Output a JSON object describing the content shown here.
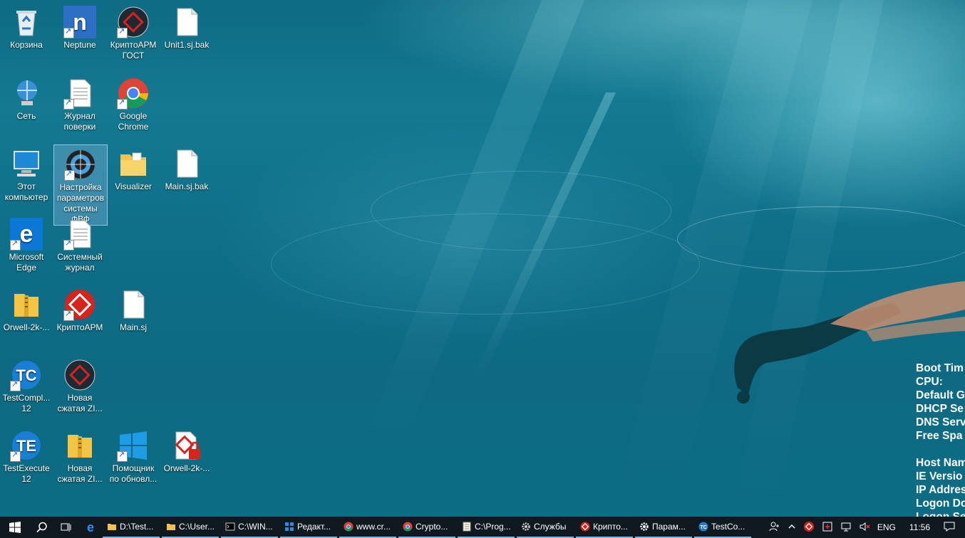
{
  "desktop": {
    "icons": [
      {
        "label": "Корзина"
      },
      {
        "label": "Neptune"
      },
      {
        "label": "КриптоАРМ ГОСТ"
      },
      {
        "label": "Unit1.sj.bak"
      },
      {
        "label": "Сеть"
      },
      {
        "label": "Журнал поверки"
      },
      {
        "label": "Google Chrome"
      },
      {
        "label": "Этот компьютер"
      },
      {
        "label": "Настройка параметров системы ФВФ"
      },
      {
        "label": "Visualizer"
      },
      {
        "label": "Main.sj.bak"
      },
      {
        "label": "Microsoft Edge"
      },
      {
        "label": "Системный журнал"
      },
      {
        "label": "Orwell-2k-..."
      },
      {
        "label": "КриптоАРМ"
      },
      {
        "label": "Main.sj"
      },
      {
        "label": "TestCompl... 12"
      },
      {
        "label": "Новая сжатая ZI..."
      },
      {
        "label": "TestExecute 12"
      },
      {
        "label": "Новая сжатая ZI..."
      },
      {
        "label": "Помощник по обновл..."
      },
      {
        "label": "Orwell-2k-..."
      }
    ]
  },
  "bginfo": {
    "lines": [
      "Boot Tim",
      "CPU:",
      "Default G",
      "DHCP Se",
      "DNS Serv",
      "Free Spa",
      "",
      "Host Nam",
      "IE Versio",
      "IP Addres",
      "Logon Do",
      "Logon Se"
    ]
  },
  "taskbar": {
    "tasks": [
      {
        "label": "D:\\Test...",
        "icon": "folder-icon"
      },
      {
        "label": "C:\\User...",
        "icon": "folder-icon"
      },
      {
        "label": "C:\\WIN...",
        "icon": "console-icon"
      },
      {
        "label": "Редакт...",
        "icon": "editor-icon"
      },
      {
        "label": "www.cr...",
        "icon": "chrome-icon"
      },
      {
        "label": "Crypto...",
        "icon": "chrome-icon"
      },
      {
        "label": "C:\\Prog...",
        "icon": "notepad-icon"
      },
      {
        "label": "Службы",
        "icon": "gear-icon"
      },
      {
        "label": "Крипто...",
        "icon": "crypto-icon"
      },
      {
        "label": "Парам...",
        "icon": "gear-icon"
      },
      {
        "label": "TestCo...",
        "icon": "testcomplete-icon"
      }
    ],
    "tray": {
      "language": "ENG",
      "time": "11:56"
    }
  },
  "colors": {
    "taskbar": "#101820",
    "accent": "#76b9ed"
  }
}
